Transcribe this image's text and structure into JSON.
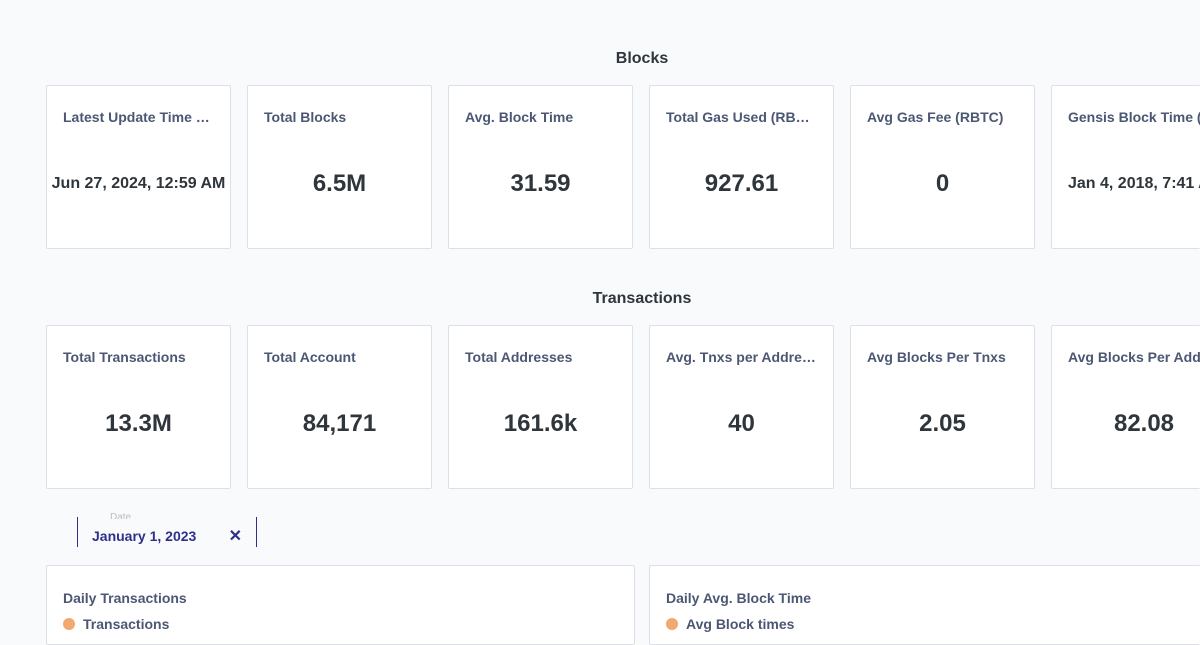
{
  "blocks": {
    "title": "Blocks",
    "cards": [
      {
        "label": "Latest Update Time (…",
        "value": "Jun 27, 2024, 12:59 AM"
      },
      {
        "label": "Total Blocks",
        "value": "6.5M"
      },
      {
        "label": "Avg. Block Time",
        "value": "31.59"
      },
      {
        "label": "Total Gas Used (RBTC)",
        "value": "927.61"
      },
      {
        "label": "Avg Gas Fee (RBTC)",
        "value": "0"
      },
      {
        "label": "Gensis Block Time (",
        "value": "Jan 4, 2018, 7:41 A"
      }
    ]
  },
  "transactions": {
    "title": "Transactions",
    "cards": [
      {
        "label": "Total Transactions",
        "value": "13.3M"
      },
      {
        "label": "Total Account",
        "value": "84,171"
      },
      {
        "label": "Total Addresses",
        "value": "161.6k"
      },
      {
        "label": "Avg. Tnxs per Address",
        "value": "40"
      },
      {
        "label": "Avg Blocks Per Tnxs",
        "value": "2.05"
      },
      {
        "label": "Avg Blocks Per Add",
        "value": "82.08"
      }
    ]
  },
  "filter": {
    "caption": "Date",
    "value": "January 1, 2023",
    "clear_icon": "close-icon"
  },
  "charts": [
    {
      "title": "Daily Transactions",
      "legend": "Transactions"
    },
    {
      "title": "Daily Avg. Block Time",
      "legend": "Avg Block times"
    }
  ],
  "colors": {
    "accent": "#2f2f8a",
    "legend_dot": "#f2a86f"
  }
}
